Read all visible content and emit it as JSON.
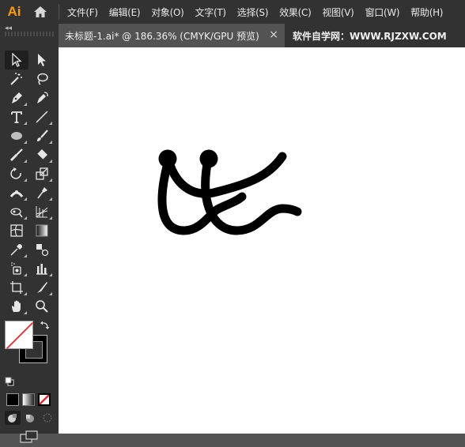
{
  "app": {
    "logo": "Ai"
  },
  "menu": {
    "items": [
      "文件(F)",
      "编辑(E)",
      "对象(O)",
      "文字(T)",
      "选择(S)",
      "效果(C)",
      "视图(V)",
      "窗口(W)",
      "帮助(H)"
    ]
  },
  "tabs": {
    "document_title": "未标题-1.ai* @ 186.36% (CMYK/GPU 预览)",
    "close_label": "×",
    "site_label": "软件自学网：WWW.RJZXW.COM"
  },
  "toolbar": {
    "collapse_label": "◂◂",
    "tools": [
      "selection-tool",
      "direct-selection-tool",
      "magic-wand-tool",
      "lasso-tool",
      "pen-tool",
      "curvature-tool",
      "type-tool",
      "line-segment-tool",
      "ellipse-tool",
      "paintbrush-tool",
      "blob-brush-tool",
      "eraser-tool",
      "rotate-tool",
      "scale-tool",
      "width-tool",
      "puppet-warp-tool",
      "shape-builder-tool",
      "perspective-grid-tool",
      "mesh-tool",
      "gradient-tool",
      "eyedropper-tool",
      "blend-tool",
      "symbol-sprayer-tool",
      "column-graph-tool",
      "artboard-tool",
      "slice-tool",
      "hand-tool",
      "zoom-tool"
    ],
    "colors": {
      "fill": "#ffffff",
      "stroke": "#000000",
      "none_slash": "#e0282b"
    }
  }
}
